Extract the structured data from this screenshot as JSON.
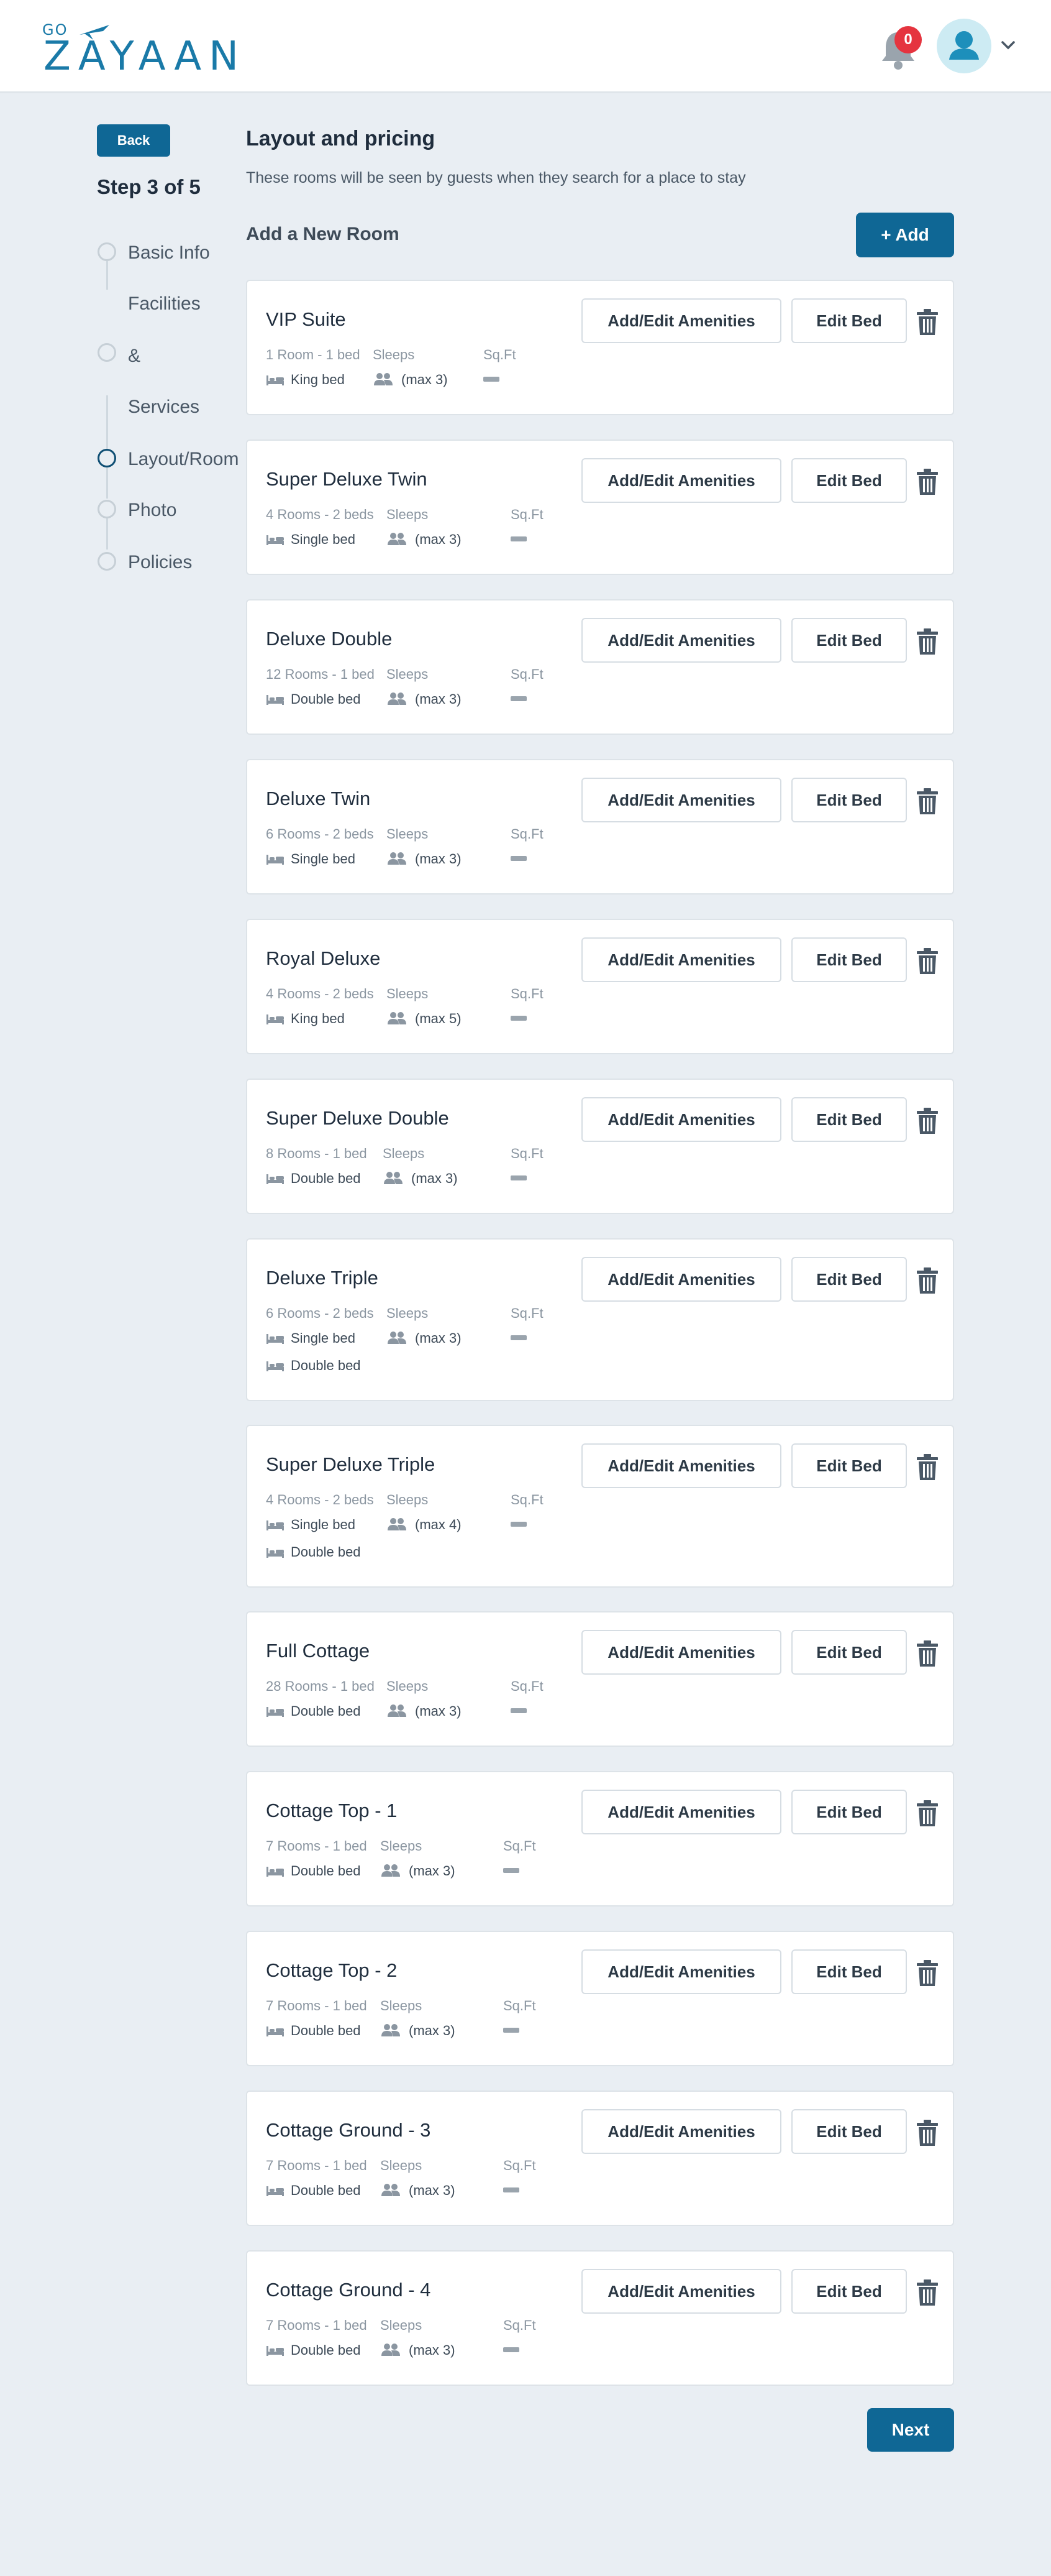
{
  "header": {
    "logo_top": "GO",
    "logo_word": "ZAYAAN",
    "notification_count": "0",
    "icons": [
      "bell-icon",
      "user-avatar-icon",
      "chevron-down-icon"
    ],
    "brand_color": "#0f6795",
    "badge_color": "#e5343f"
  },
  "sidebar": {
    "back_label": "Back",
    "step_title": "Step 3 of 5",
    "steps": [
      {
        "label": "Basic Info",
        "active": false
      },
      {
        "label": "Facilities",
        "active": false
      },
      {
        "label": "&",
        "active": false
      },
      {
        "label": "Services",
        "active": false
      },
      {
        "label": "Layout/Room",
        "active": true
      },
      {
        "label": "Photo",
        "active": false
      },
      {
        "label": "Policies",
        "active": false
      }
    ]
  },
  "main": {
    "title": "Layout and pricing",
    "subtitle": "These rooms will be seen by guests when they search for a place to stay",
    "add_room_label": "Add a New Room",
    "add_button": "+ Add",
    "sleeps_label": "Sleeps",
    "sqft_label": "Sq.Ft",
    "amenities_button": "Add/Edit Amenities",
    "edit_bed_button": "Edit Bed",
    "next_button": "Next",
    "rooms": [
      {
        "name": "VIP Suite",
        "summary": "1 Room - 1 bed",
        "beds": [
          "King bed"
        ],
        "max": "(max 3)"
      },
      {
        "name": "Super Deluxe Twin",
        "summary": "4 Rooms - 2 beds",
        "beds": [
          "Single bed"
        ],
        "max": "(max 3)"
      },
      {
        "name": "Deluxe Double",
        "summary": "12 Rooms - 1 bed",
        "beds": [
          "Double bed"
        ],
        "max": "(max 3)"
      },
      {
        "name": "Deluxe Twin",
        "summary": "6 Rooms - 2 beds",
        "beds": [
          "Single bed"
        ],
        "max": "(max 3)"
      },
      {
        "name": "Royal Deluxe",
        "summary": "4 Rooms - 2 beds",
        "beds": [
          "King bed"
        ],
        "max": "(max 5)"
      },
      {
        "name": "Super Deluxe Double",
        "summary": "8 Rooms - 1 bed",
        "beds": [
          "Double bed"
        ],
        "max": "(max 3)"
      },
      {
        "name": "Deluxe Triple",
        "summary": "6 Rooms - 2 beds",
        "beds": [
          "Single bed",
          "Double bed"
        ],
        "max": "(max 3)"
      },
      {
        "name": "Super Deluxe Triple",
        "summary": "4 Rooms - 2 beds",
        "beds": [
          "Single bed",
          "Double bed"
        ],
        "max": "(max 4)"
      },
      {
        "name": "Full Cottage",
        "summary": "28 Rooms - 1 bed",
        "beds": [
          "Double bed"
        ],
        "max": "(max 3)"
      },
      {
        "name": "Cottage Top - 1",
        "summary": "7 Rooms - 1 bed",
        "beds": [
          "Double bed"
        ],
        "max": "(max 3)"
      },
      {
        "name": "Cottage Top - 2",
        "summary": "7 Rooms - 1 bed",
        "beds": [
          "Double bed"
        ],
        "max": "(max 3)"
      },
      {
        "name": "Cottage Ground - 3",
        "summary": "7 Rooms - 1 bed",
        "beds": [
          "Double bed"
        ],
        "max": "(max 3)"
      },
      {
        "name": "Cottage Ground - 4",
        "summary": "7 Rooms - 1 bed",
        "beds": [
          "Double bed"
        ],
        "max": "(max 3)"
      }
    ]
  }
}
